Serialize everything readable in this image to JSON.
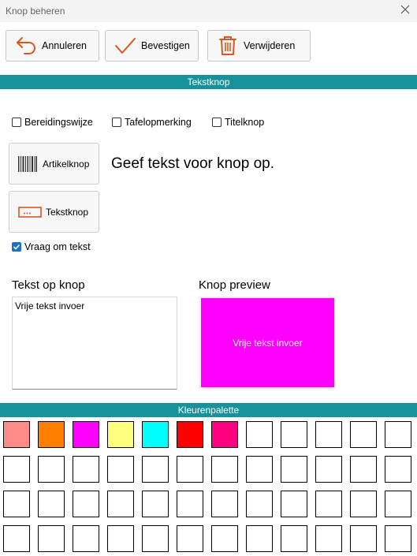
{
  "window": {
    "title": "Knop beheren",
    "close_icon": "close-icon"
  },
  "toolbar": {
    "cancel_label": "Annuleren",
    "confirm_label": "Bevestigen",
    "delete_label": "Verwijderen",
    "accent_color": "#d9571d"
  },
  "section_text_button": "Tekstknop",
  "options": {
    "preparation_label": "Bereidingswijze",
    "table_marker_label": "Tafelopmerking",
    "title_button_label": "Titelknop",
    "preparation_checked": false,
    "table_marker_checked": false,
    "title_button_checked": false
  },
  "types": {
    "article_label": "Artikelknop",
    "text_label": "Tekstknop"
  },
  "instruction": "Geef tekst voor knop op.",
  "ask_text": {
    "label": "Vraag om tekst",
    "checked": true
  },
  "text_on_button": {
    "heading": "Tekst op knop",
    "value": "Vrije tekst invoer"
  },
  "preview": {
    "heading": "Knop preview",
    "text": "Vrije tekst invoer",
    "color": "#ff00ff"
  },
  "palette": {
    "title": "Kleurenpalette",
    "colors": [
      "#ff8a8a",
      "#ff7f00",
      "#ff00ff",
      "#ffff80",
      "#00ffff",
      "#ff0000",
      "#ff0080",
      "#ffffff",
      "#ffffff",
      "#ffffff",
      "#ffffff",
      "#ffffff",
      "#ffffff",
      "#ffffff",
      "#ffffff",
      "#ffffff",
      "#ffffff",
      "#ffffff",
      "#ffffff",
      "#ffffff",
      "#ffffff",
      "#ffffff",
      "#ffffff",
      "#ffffff",
      "#ffffff",
      "#ffffff",
      "#ffffff",
      "#ffffff",
      "#ffffff",
      "#ffffff",
      "#ffffff",
      "#ffffff",
      "#ffffff",
      "#ffffff",
      "#ffffff",
      "#ffffff",
      "#ffffff",
      "#ffffff",
      "#ffffff",
      "#ffffff",
      "#ffffff",
      "#ffffff",
      "#ffffff",
      "#ffffff",
      "#ffffff",
      "#ffffff",
      "#ffffff",
      "#ffffff"
    ]
  }
}
